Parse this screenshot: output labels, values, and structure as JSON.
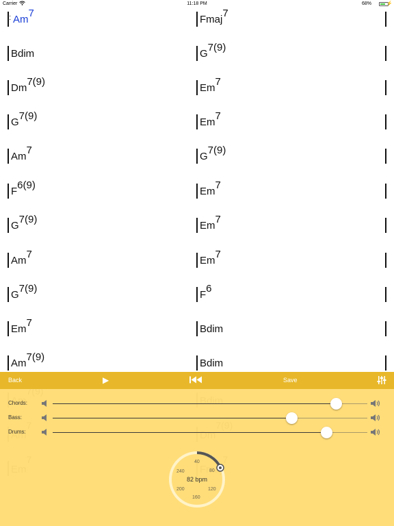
{
  "status_bar": {
    "carrier": "Carrier",
    "time": "11:18 PM",
    "battery_percent": "68%",
    "battery_level": 0.68
  },
  "sheet": {
    "rows": [
      {
        "left": {
          "root": "Am",
          "ext": "7",
          "active": true,
          "repeat_start": true
        },
        "right": {
          "root": "Fmaj",
          "ext": "7"
        }
      },
      {
        "left": {
          "root": "Bdim",
          "ext": ""
        },
        "right": {
          "root": "G",
          "ext": "7(9)"
        }
      },
      {
        "left": {
          "root": "Dm",
          "ext": "7(9)"
        },
        "right": {
          "root": "Em",
          "ext": "7"
        }
      },
      {
        "left": {
          "root": "G",
          "ext": "7(9)"
        },
        "right": {
          "root": "Em",
          "ext": "7"
        }
      },
      {
        "left": {
          "root": "Am",
          "ext": "7"
        },
        "right": {
          "root": "G",
          "ext": "7(9)"
        }
      },
      {
        "left": {
          "root": "F",
          "ext": "6(9)"
        },
        "right": {
          "root": "Em",
          "ext": "7"
        }
      },
      {
        "left": {
          "root": "G",
          "ext": "7(9)"
        },
        "right": {
          "root": "Em",
          "ext": "7"
        }
      },
      {
        "left": {
          "root": "Am",
          "ext": "7"
        },
        "right": {
          "root": "Em",
          "ext": "7"
        }
      },
      {
        "left": {
          "root": "G",
          "ext": "7(9)"
        },
        "right": {
          "root": "F",
          "ext": "6"
        }
      },
      {
        "left": {
          "root": "Em",
          "ext": "7"
        },
        "right": {
          "root": "Bdim",
          "ext": ""
        }
      },
      {
        "left": {
          "root": "Am",
          "ext": "7(9)"
        },
        "right": {
          "root": "Bdim",
          "ext": ""
        }
      }
    ]
  },
  "toolbar": {
    "back_label": "Back",
    "save_label": "Save"
  },
  "mixer": {
    "chords_label": "Chords:",
    "bass_label": "Bass:",
    "drums_label": "Drums:",
    "chords_level": 0.9,
    "bass_level": 0.76,
    "drums_level": 0.87
  },
  "tempo": {
    "bpm_label": "82 bpm",
    "ticks": [
      "40",
      "80",
      "120",
      "160",
      "200",
      "240"
    ]
  },
  "colors": {
    "toolbar": "#e8b82a",
    "panel": "#ffd65c",
    "active_chord": "#1b3fd6"
  }
}
